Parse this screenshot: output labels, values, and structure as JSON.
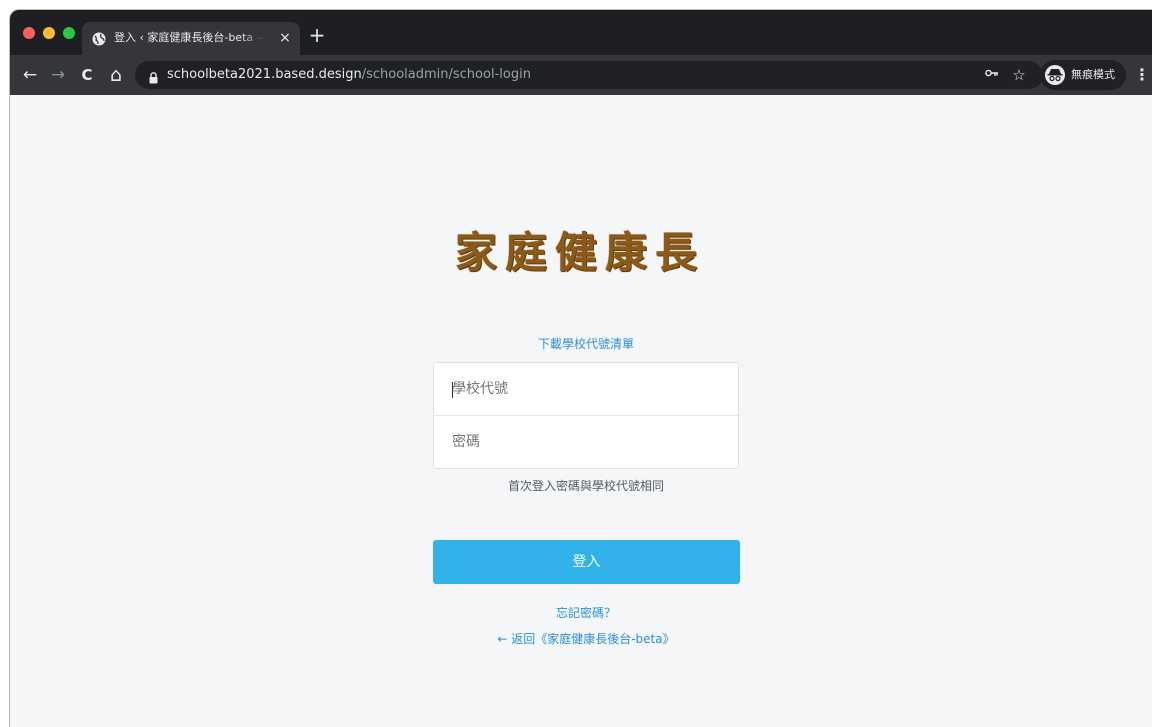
{
  "browser": {
    "tab_title": "登入 ‹ 家庭健康長後台-beta — W",
    "tab_close": "×",
    "new_tab": "+",
    "nav": {
      "back": "←",
      "forward": "→",
      "reload": "C",
      "home": "⌂"
    },
    "url_host": "schoolbeta2021.based.design",
    "url_path": "/schooladmin/school-login",
    "key_icon": "⊸",
    "star_icon": "☆",
    "incognito_label": "無痕模式",
    "menu_icon": "⋮"
  },
  "page": {
    "logo_text": "家庭健康長",
    "download_link": "下載學校代號清單",
    "school_code_placeholder": "學校代號",
    "password_placeholder": "密碼",
    "hint": "首次登入密碼與學校代號相同",
    "login_button": "登入",
    "forgot_password": "忘記密碼？",
    "back_link": "← 返回《家庭健康長後台-beta》"
  },
  "colors": {
    "accent": "#31b2ea",
    "link": "#2b8fd6",
    "logo": "#8c5a16",
    "background": "#f5f6f8"
  }
}
